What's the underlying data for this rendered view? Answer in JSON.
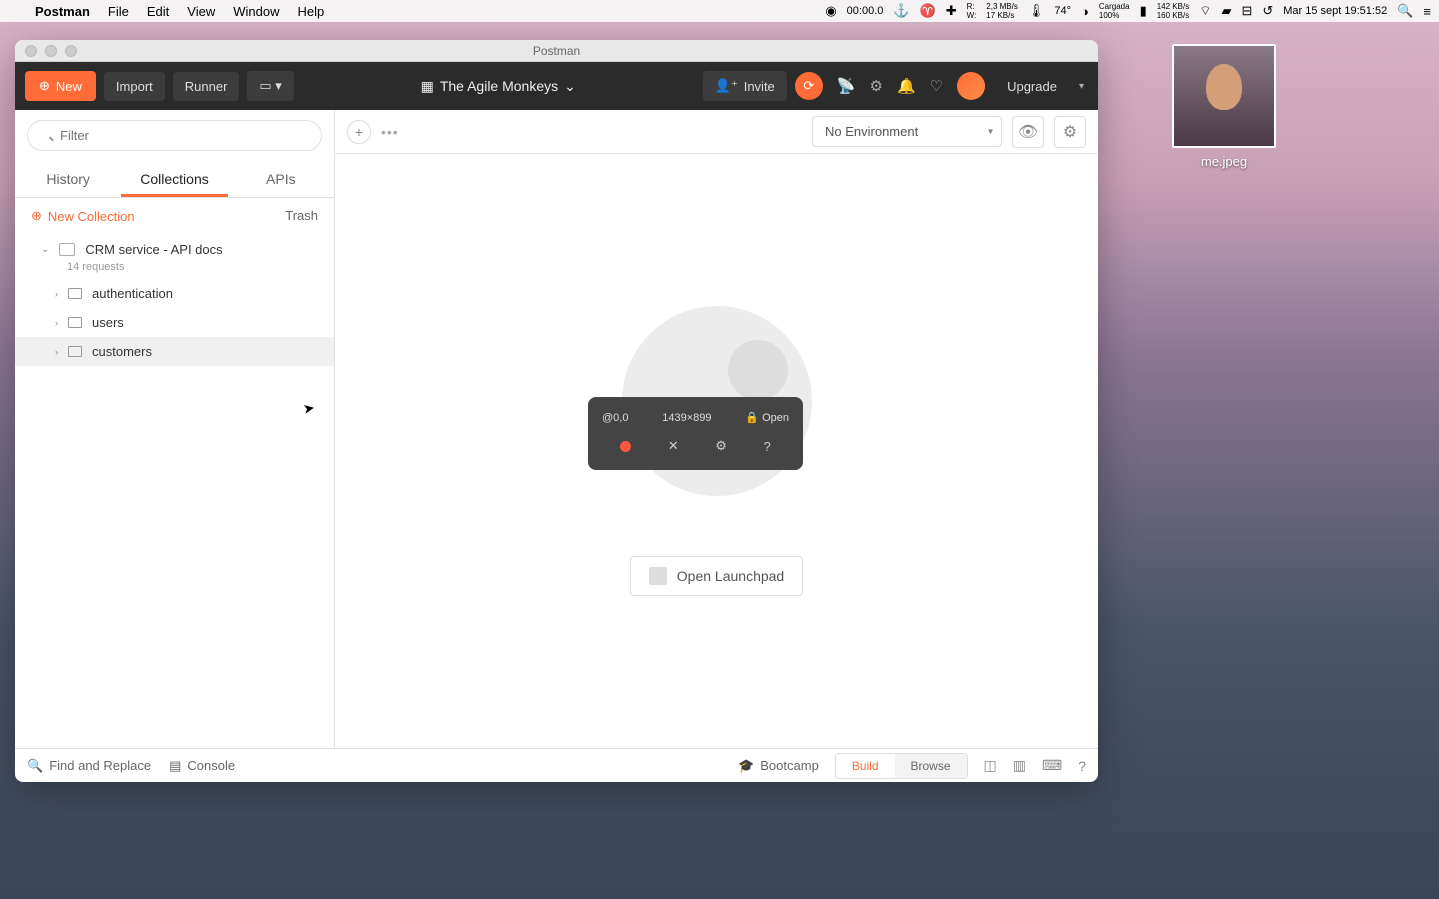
{
  "menubar": {
    "app": "Postman",
    "items": [
      "File",
      "Edit",
      "View",
      "Window",
      "Help"
    ],
    "timer": "00:00.0",
    "net_r": "R:",
    "net_w": "W:",
    "net_r_val": "2,3 MB/s",
    "net_w_val": "17 KB/s",
    "temp": "74°",
    "battery": "Cargada",
    "battery_pct": "100%",
    "disk_up": "142 KB/s",
    "disk_down": "160 KB/s",
    "datetime": "Mar 15 sept  19:51:52"
  },
  "desktop": {
    "filename": "me.jpeg"
  },
  "window": {
    "title": "Postman"
  },
  "toolbar": {
    "new": "New",
    "import": "Import",
    "runner": "Runner",
    "workspace": "The Agile Monkeys",
    "invite": "Invite",
    "upgrade": "Upgrade"
  },
  "sidebar": {
    "filter_placeholder": "Filter",
    "tabs": {
      "history": "History",
      "collections": "Collections",
      "apis": "APIs"
    },
    "new_collection": "New Collection",
    "trash": "Trash",
    "collection": {
      "name": "CRM service - API docs",
      "count": "14 requests"
    },
    "folders": [
      "authentication",
      "users",
      "customers"
    ]
  },
  "main": {
    "env": "No Environment",
    "launchpad": "Open Launchpad"
  },
  "rec": {
    "pos": "@0,0",
    "size": "1439×899",
    "open": "Open"
  },
  "footer": {
    "find": "Find and Replace",
    "console": "Console",
    "bootcamp": "Bootcamp",
    "build": "Build",
    "browse": "Browse"
  }
}
